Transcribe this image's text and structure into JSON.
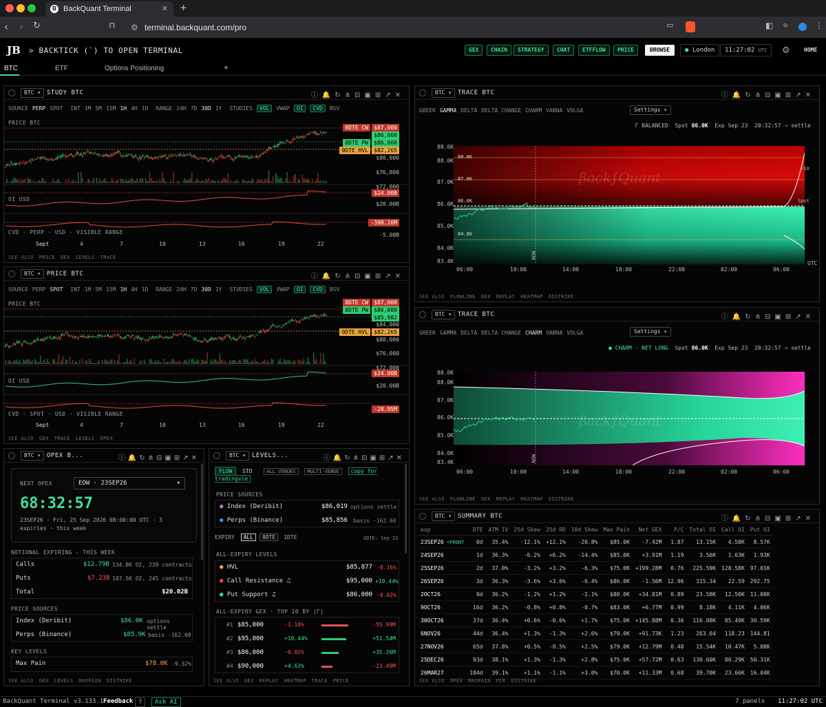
{
  "browser": {
    "tab_title": "BackQuant Terminal",
    "url": "terminal.backquant.com/pro"
  },
  "header": {
    "logo": "JB",
    "prompt": "> BACKTICK (`) TO OPEN TERMINAL",
    "nav": [
      "GEX",
      "CHAIN",
      "STRATEGY",
      "CHAT",
      "ETFFLOW",
      "PRICE"
    ],
    "browse": "BROWSE",
    "location": "London",
    "time": "11:27:02",
    "tz": "UTC",
    "home": "HOME"
  },
  "tabs": [
    "BTC",
    "ETF",
    "Options Positioning",
    "+"
  ],
  "study": {
    "sym": "BTC",
    "title": "STUDY BTC",
    "source_label": "SOURCE",
    "sources": [
      "PERP",
      "SPOT"
    ],
    "int_label": "INT",
    "ints": [
      "1M",
      "5M",
      "15M",
      "1H",
      "4H",
      "1D"
    ],
    "range_label": "RANGE",
    "ranges": [
      "24H",
      "7D",
      "30D",
      "1Y"
    ],
    "studies_label": "STUDIES",
    "studies": [
      "VOL",
      "VWAP",
      "OI",
      "CVD",
      "BSV"
    ],
    "price_label": "PRICE BTC",
    "oi_label": "OI USD",
    "cvd_label": "CVD · PERP · USD · VISIBLE RANGE",
    "tags": {
      "cw": "0DTE CW",
      "cw_v": "$87,000",
      "p1": "$86,060",
      "pw": "0DTE PW",
      "pw_v": "$86,000",
      "hvl": "0DTE HVL",
      "hvl_v": "$82,265",
      "p80": "$80,000",
      "p76": "$76,000",
      "p72": "$72,000",
      "oi_v": "$24.00B",
      "oi_20": "$20.00B",
      "cvd_v": "-398.16M",
      "cvd_5": "-5.00B"
    },
    "xticks": [
      "Sept",
      "4",
      "7",
      "10",
      "13",
      "16",
      "19",
      "22"
    ],
    "see": [
      "SEE ALSO",
      "PRICE",
      "GEX",
      "LEVELS",
      "TRACE"
    ]
  },
  "price": {
    "sym": "BTC",
    "title": "PRICE BTC",
    "source_label": "SOURCE",
    "sources": [
      "PERP",
      "SPOT"
    ],
    "int_label": "INT",
    "ints": [
      "1M",
      "5M",
      "15M",
      "1H",
      "4H",
      "1D"
    ],
    "range_label": "RANGE",
    "ranges": [
      "24H",
      "7D",
      "30D",
      "1Y"
    ],
    "studies_label": "STUDIES",
    "studies": [
      "VOL",
      "VWAP",
      "OI",
      "CVD",
      "BSV"
    ],
    "price_label": "PRICE BTC",
    "oi_label": "OI USD",
    "cvd_label": "CVD · SPOT · USD · VISIBLE RANGE",
    "tags": {
      "cw": "0DTE CW",
      "cw_v": "$87,000",
      "pw": "0DTE PW",
      "pw_v": "$86,000",
      "p1": "$85,982",
      "p84": "$84,000",
      "hvl": "0DTE HVL",
      "hvl_v": "$82,265",
      "p80": "$80,000",
      "p76": "$76,000",
      "p72": "$72,000",
      "oi_v": "$24.00B",
      "oi_20": "$20.00B",
      "oi_28": "$28.00B",
      "cvd_v": "-28.95M"
    },
    "xticks": [
      "Sept",
      "4",
      "7",
      "10",
      "13",
      "16",
      "19",
      "22"
    ],
    "see": [
      "SEE ALSO",
      "GEX",
      "TRACE",
      "LEVELS",
      "OPEX"
    ]
  },
  "trace1": {
    "sym": "BTC",
    "title": "TRACE BTC",
    "greeks": [
      "GREEK",
      "GAMMA",
      "DELTA",
      "DELTA CHANGE",
      "CHARM",
      "VANNA",
      "VOLGA"
    ],
    "settings": "Settings +",
    "status": "Γ BALANCED",
    "spot_label": "Spot",
    "spot": "86.0K",
    "exp": "Exp Sep 23",
    "countdown": "20:32:57 → settle",
    "yticks": [
      "88.6K",
      "88.0K",
      "87.0K",
      "86.0K",
      "85.0K",
      "84.0K",
      "83.4K"
    ],
    "xticks": [
      "06:00",
      "10:00",
      "14:00",
      "18:00",
      "22:00",
      "02:00",
      "06:00"
    ],
    "lvls": [
      "88.0K",
      "87.0K",
      "86.0K",
      "84.6K"
    ],
    "now": "NOW",
    "spot_tag": "Spot",
    "plus": "+1σ",
    "tz": "UTC",
    "see": [
      "SEE ALSO",
      "FLOWLINE",
      "GEX",
      "REPLAY",
      "HEATMAP",
      "OISTRIKE"
    ]
  },
  "trace2": {
    "sym": "BTC",
    "title": "TRACE BTC",
    "greeks": [
      "GREEK",
      "GAMMA",
      "DELTA",
      "DELTA CHANGE",
      "CHARM",
      "VANNA",
      "VOLGA"
    ],
    "settings": "Settings +",
    "status": "● CHARM · NET LONG",
    "spot_label": "Spot",
    "spot": "86.0K",
    "exp": "Exp Sep 23",
    "countdown": "20:32:57 → settle",
    "yticks": [
      "88.6K",
      "88.0K",
      "87.0K",
      "86.0K",
      "85.0K",
      "84.0K",
      "83.4K"
    ],
    "xticks": [
      "06:00",
      "10:00",
      "14:00",
      "18:00",
      "22:00",
      "02:00",
      "06:00"
    ],
    "now": "NOW",
    "see": [
      "SEE ALSO",
      "FLOWLINE",
      "GEX",
      "REPLAY",
      "HEATMAP",
      "OISTRIKE"
    ]
  },
  "opex": {
    "sym": "BTC",
    "title": "OPEX B...",
    "next_label": "NEXT OPEX",
    "select": "EOW · 23SEP26",
    "countdown": "68:32:57",
    "date": "23SEP26 · Fri, 25 Sep 2026 08:00:00 UTC · 3",
    "sub": "expiries · this week",
    "notional_label": "NOTIONAL EXPIRING · THIS WEEK",
    "calls": {
      "l": "Calls",
      "v": "$12.79B",
      "d": "134.8K OI, 239 contracts"
    },
    "puts": {
      "l": "Puts",
      "v": "$7.23B",
      "d": "107.5K OI, 245 contracts"
    },
    "total": {
      "l": "Total",
      "v": "$20.02B"
    },
    "ps_label": "PRICE SOURCES",
    "idx": {
      "l": "Index (Deribit)",
      "v": "$86.0K",
      "d": "options settle"
    },
    "perp": {
      "l": "Perps (Binance)",
      "v": "$85.9K",
      "d": "basis -162.60"
    },
    "kl_label": "KEY LEVELS",
    "maxpain": {
      "l": "Max Pain",
      "v": "$78.0K",
      "d": "-9.32%"
    },
    "see": [
      "SEE ALSO",
      "GEX",
      "LEVELS",
      "MAXPAIN",
      "OISTRIKE"
    ]
  },
  "levels": {
    "sym": "BTC",
    "title": "LEVELS...",
    "tabs": [
      "FLOW",
      "STD"
    ],
    "venues": [
      "ALL VENUES",
      "MULTI-VENUE"
    ],
    "copy": "copy for tradingvie",
    "ps_label": "PRICE SOURCES",
    "idx": {
      "l": "Index (Deribit)",
      "v": "$86,019",
      "d": "options settle"
    },
    "perp": {
      "l": "Perps (Binance)",
      "v": "$85,856",
      "d": "basis -162.60"
    },
    "expiry_label": "EXPIRY",
    "exp": [
      "ALL",
      "0DTE",
      "1DTE"
    ],
    "dte_note": "0DTE: Sep 22",
    "all_label": "ALL-EXPIRY LEVELS",
    "hvl": {
      "l": "HVL",
      "v": "$85,877",
      "c": "-0.16%"
    },
    "cr": {
      "l": "Call Resistance",
      "v": "$95,000",
      "c": "+10.44%"
    },
    "psup": {
      "l": "Put Support",
      "v": "$86,000",
      "c": "-0.02%"
    },
    "gex_label": "ALL-EXPIRY GEX · TOP 10 BY |Γ|",
    "gex": [
      {
        "r": "#1",
        "k": "$85,000",
        "c": "-1.18%",
        "v": "-55.99M"
      },
      {
        "r": "#2",
        "k": "$95,000",
        "c": "+10.44%",
        "v": "+51.54M"
      },
      {
        "r": "#3",
        "k": "$86,000",
        "c": "-0.02%",
        "v": "+35.26M"
      },
      {
        "r": "#4",
        "k": "$90,000",
        "c": "+4.63%",
        "v": "-23.49M"
      }
    ],
    "see": [
      "SEE ALSO",
      "GEX",
      "REPLAY",
      "HEATMAP",
      "TRACE",
      "PRICE"
    ]
  },
  "summary": {
    "sym": "BTC",
    "title": "SUMMARY BTC",
    "cols": [
      "exp",
      "DTE",
      "ATM IV",
      "25d Skew",
      "25d RR",
      "10d Skew",
      "Max Pain",
      "Net GEX",
      "P/C",
      "Total OI",
      "Call OI",
      "Put OI"
    ],
    "rows": [
      [
        "23SEP26",
        "0d",
        "35.4%",
        "-12.1%",
        "+12.1%",
        "-20.8%",
        "$85.0K",
        "-7.42M",
        "1.87",
        "13.15K",
        "4.58K",
        "8.57K"
      ],
      [
        "24SEP26",
        "1d",
        "36.3%",
        "-6.2%",
        "+6.2%",
        "-14.4%",
        "$85.0K",
        "+3.91M",
        "1.19",
        "3.56K",
        "1.63K",
        "1.93K"
      ],
      [
        "25SEP26",
        "2d",
        "37.0%",
        "-3.2%",
        "+3.2%",
        "-6.3%",
        "$75.0K",
        "+199.28M",
        "0.76",
        "225.59K",
        "128.58K",
        "97.01K"
      ],
      [
        "26SEP26",
        "3d",
        "36.3%",
        "-3.6%",
        "+3.6%",
        "-6.4%",
        "$86.0K",
        "-1.56M",
        "12.96",
        "315.34",
        "22.59",
        "292.75"
      ],
      [
        "2OCT26",
        "9d",
        "36.2%",
        "-1.2%",
        "+1.2%",
        "-2.1%",
        "$80.0K",
        "+34.81M",
        "0.89",
        "23.58K",
        "12.50K",
        "11.08K"
      ],
      [
        "9OCT26",
        "16d",
        "36.2%",
        "-0.8%",
        "+0.8%",
        "-0.7%",
        "$83.0K",
        "+6.77M",
        "0.99",
        "8.18K",
        "4.11K",
        "4.06K"
      ],
      [
        "30OCT26",
        "37d",
        "36.4%",
        "+0.6%",
        "-0.6%",
        "+1.7%",
        "$75.0K",
        "+145.88M",
        "0.36",
        "116.08K",
        "85.49K",
        "30.59K"
      ],
      [
        "6NOV26",
        "44d",
        "36.4%",
        "+1.3%",
        "-1.3%",
        "+2.6%",
        "$79.0K",
        "+91.73K",
        "1.23",
        "263.04",
        "118.23",
        "144.81"
      ],
      [
        "27NOV26",
        "65d",
        "37.8%",
        "+0.5%",
        "-0.5%",
        "+2.5%",
        "$79.0K",
        "+12.79M",
        "0.48",
        "15.54K",
        "10.47K",
        "5.08K"
      ],
      [
        "25DEC26",
        "93d",
        "38.1%",
        "+1.3%",
        "-1.3%",
        "+2.8%",
        "$75.0K",
        "+57.72M",
        "0.63",
        "130.60K",
        "80.29K",
        "50.31K"
      ],
      [
        "26MAR27",
        "184d",
        "39.1%",
        "+1.1%",
        "-1.1%",
        "+3.0%",
        "$70.0K",
        "+11.33M",
        "0.68",
        "39.70K",
        "23.66K",
        "16.04K"
      ]
    ],
    "front": "•FRONT",
    "see": [
      "SEE ALSO",
      "OPEX",
      "MAXPAIN",
      "PCR",
      "OISTRIKE"
    ]
  },
  "status": {
    "version": "BackQuant Terminal v3.133.1",
    "feedback": "Feedback",
    "q": "?",
    "ask": "Ask AI",
    "panels": "7 panels",
    "time": "11:27:02 UTC"
  }
}
